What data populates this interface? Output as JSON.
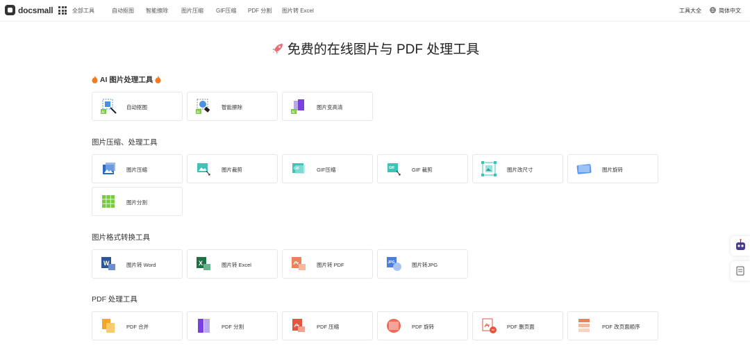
{
  "header": {
    "logo_bold": "doc",
    "logo_rest": "small",
    "all_tools": "全部工具",
    "nav": [
      "自动抠图",
      "智能擦除",
      "图片压缩",
      "GIF压缩",
      "PDF 分割",
      "图片转 Excel"
    ],
    "tools_all": "工具大全",
    "language": "简体中文"
  },
  "hero": {
    "title": "免费的在线图片与 PDF 处理工具",
    "icon": "rocket-icon"
  },
  "sections": [
    {
      "title": "AI 图片处理工具",
      "items": [
        {
          "label": "自动抠图",
          "icon": "ai-cutout-icon"
        },
        {
          "label": "智能擦除",
          "icon": "ai-erase-icon"
        },
        {
          "label": "图片变高清",
          "icon": "ai-enhance-icon"
        }
      ]
    },
    {
      "title": "图片压缩、处理工具",
      "items": [
        {
          "label": "图片压缩",
          "icon": "image-compress-icon"
        },
        {
          "label": "图片裁剪",
          "icon": "image-crop-icon"
        },
        {
          "label": "GIF压缩",
          "icon": "gif-compress-icon"
        },
        {
          "label": "GIF 裁剪",
          "icon": "gif-crop-icon"
        },
        {
          "label": "图片改尺寸",
          "icon": "image-resize-icon"
        },
        {
          "label": "图片旋转",
          "icon": "image-rotate-icon"
        },
        {
          "label": "图片分割",
          "icon": "image-split-icon"
        }
      ]
    },
    {
      "title": "图片格式转换工具",
      "items": [
        {
          "label": "图片转 Word",
          "icon": "image-to-word-icon"
        },
        {
          "label": "图片转 Excel",
          "icon": "image-to-excel-icon"
        },
        {
          "label": "图片转 PDF",
          "icon": "image-to-pdf-icon"
        },
        {
          "label": "图片转JPG",
          "icon": "image-to-jpg-icon"
        }
      ]
    },
    {
      "title": "PDF 处理工具",
      "items": [
        {
          "label": "PDF 合并",
          "icon": "pdf-merge-icon"
        },
        {
          "label": "PDF 分割",
          "icon": "pdf-split-icon"
        },
        {
          "label": "PDF 压缩",
          "icon": "pdf-compress-icon"
        },
        {
          "label": "PDF 旋转",
          "icon": "pdf-rotate-icon"
        },
        {
          "label": "PDF 删页面",
          "icon": "pdf-delete-pages-icon"
        },
        {
          "label": "PDF 改页面顺序",
          "icon": "pdf-reorder-icon"
        }
      ]
    }
  ],
  "side": {
    "robot": "robot-icon",
    "feedback": "feedback-icon"
  },
  "colors": {
    "word": "#2b5797",
    "excel": "#1e7145",
    "pdf": "#e8533f",
    "ai": "#7ac943"
  }
}
